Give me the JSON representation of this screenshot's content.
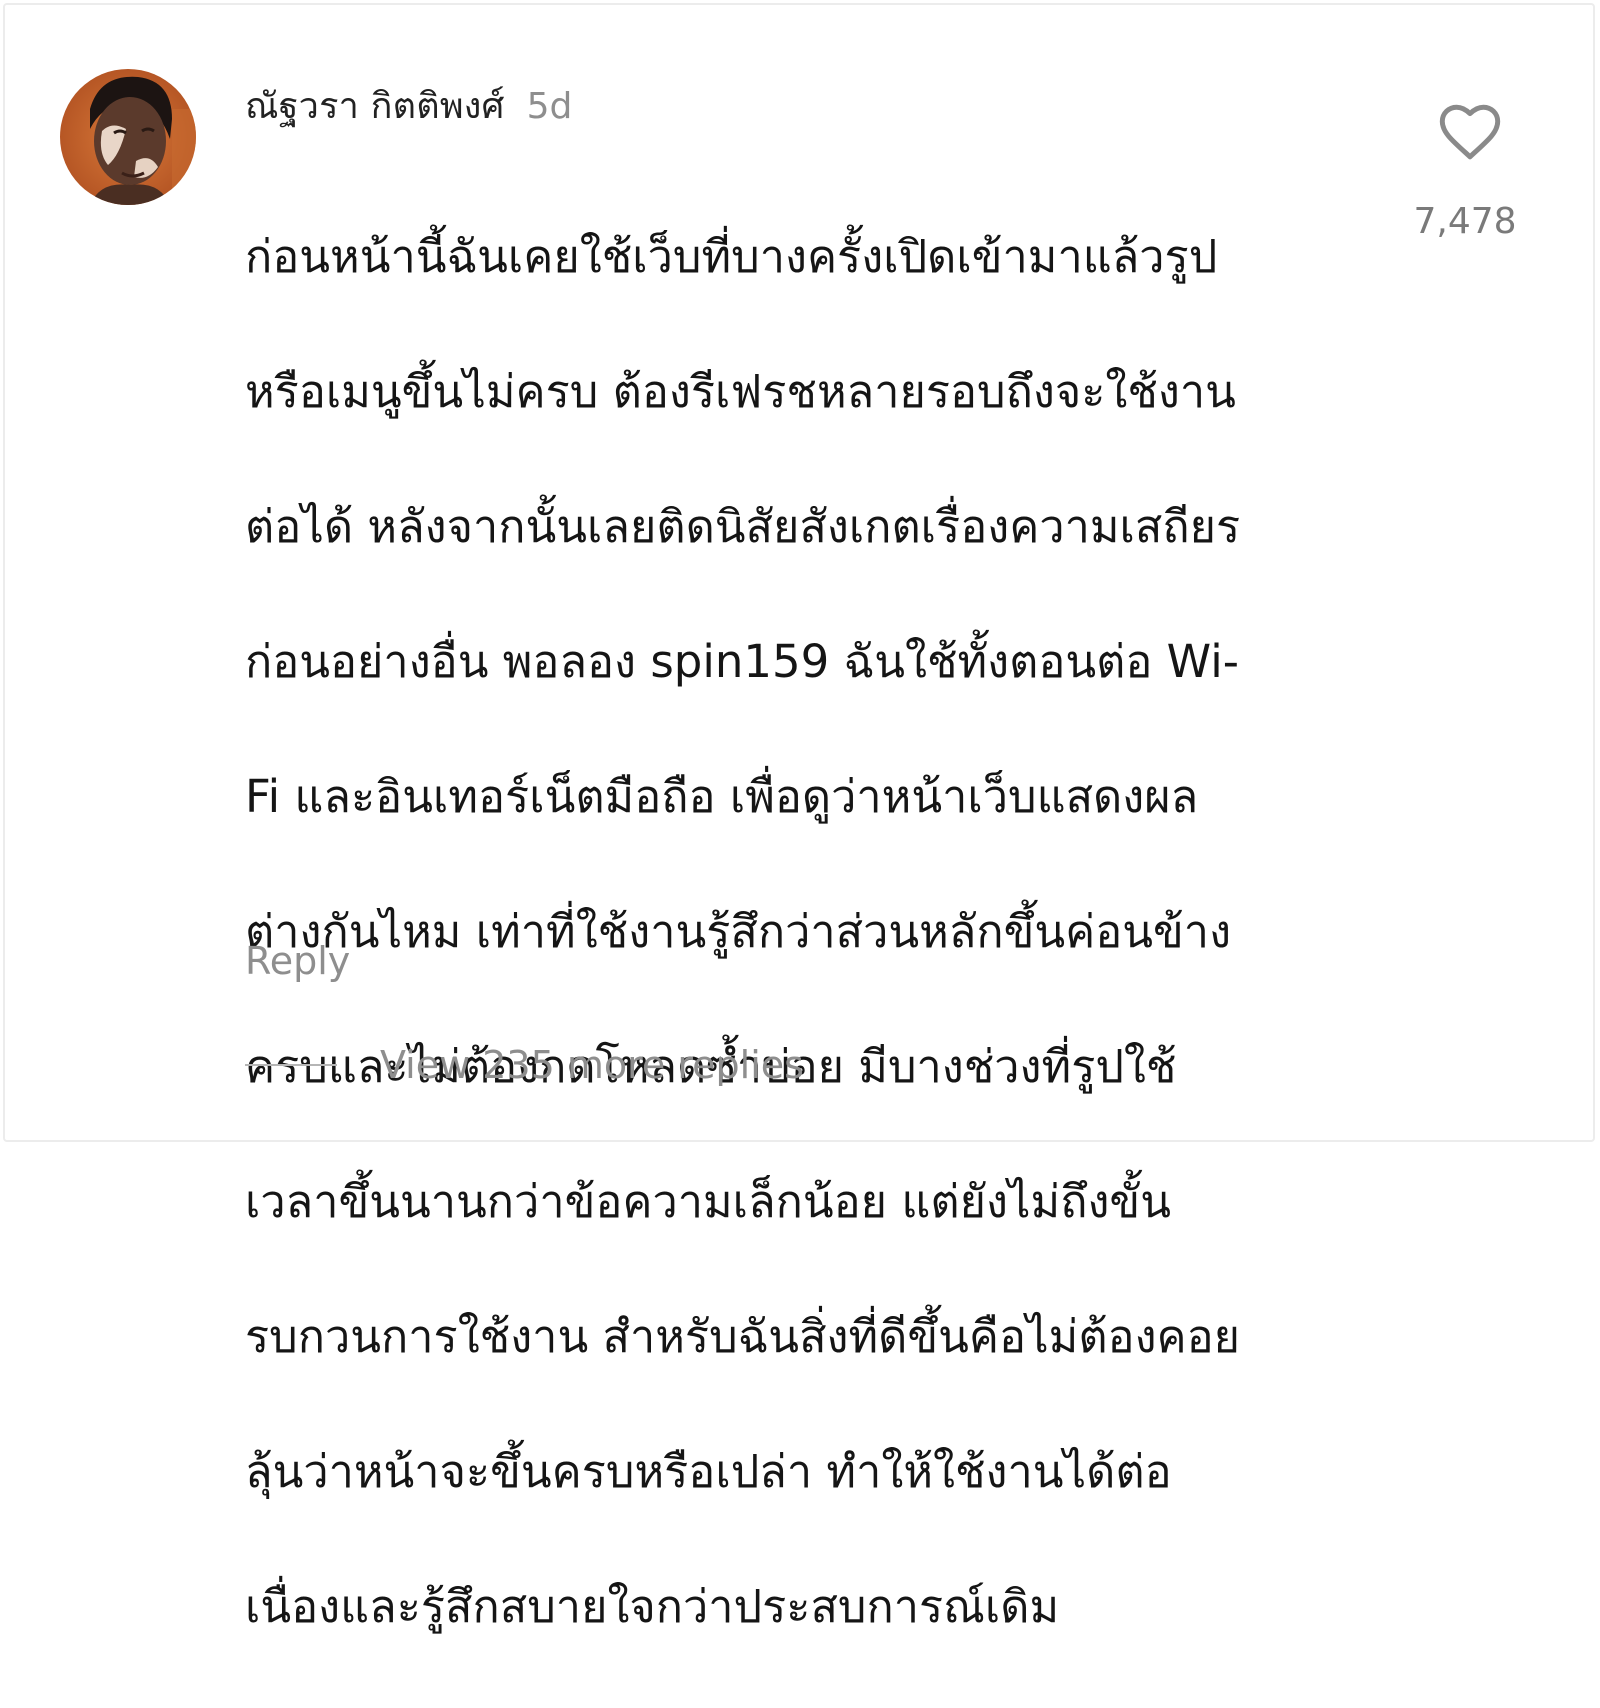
{
  "comment": {
    "username": "ณัฐวรา กิตติพงศ์",
    "timestamp": "5d",
    "text_lines": [
      "ก่อนหน้านี้ฉันเคยใช้เว็บที่บางครั้งเปิดเข้ามาแล้วรูป",
      "หรือเมนูขึ้นไม่ครบ ต้องรีเฟรชหลายรอบถึงจะใช้งาน",
      "ต่อได้ หลังจากนั้นเลยติดนิสัยสังเกตเรื่องความเสถียร",
      "ก่อนอย่างอื่น พอลอง spin159 ฉันใช้ทั้งตอนต่อ Wi-",
      "Fi และอินเทอร์เน็ตมือถือ เพื่อดูว่าหน้าเว็บแสดงผล",
      "ต่างกันไหม เท่าที่ใช้งานรู้สึกว่าส่วนหลักขึ้นค่อนข้าง",
      "ครบและไม่ต้องกดโหลดซ้ำบ่อย มีบางช่วงที่รูปใช้",
      "เวลาขึ้นนานกว่าข้อความเล็กน้อย แต่ยังไม่ถึงขั้น",
      "รบกวนการใช้งาน สำหรับฉันสิ่งที่ดีขึ้นคือไม่ต้องคอย",
      "ลุ้นว่าหน้าจะขึ้นครบหรือเปล่า ทำให้ใช้งานได้ต่อ",
      "เนื่องและรู้สึกสบายใจกว่าประสบการณ์เดิม"
    ],
    "like_count": "7,478",
    "like_icon": "heart-outline-icon",
    "reply_label": "Reply",
    "view_replies_label": "View 235 more replies"
  },
  "colors": {
    "text_primary": "#151515",
    "text_secondary": "#8e8e8e",
    "icon": "#8a8a8a",
    "background": "#ffffff"
  }
}
